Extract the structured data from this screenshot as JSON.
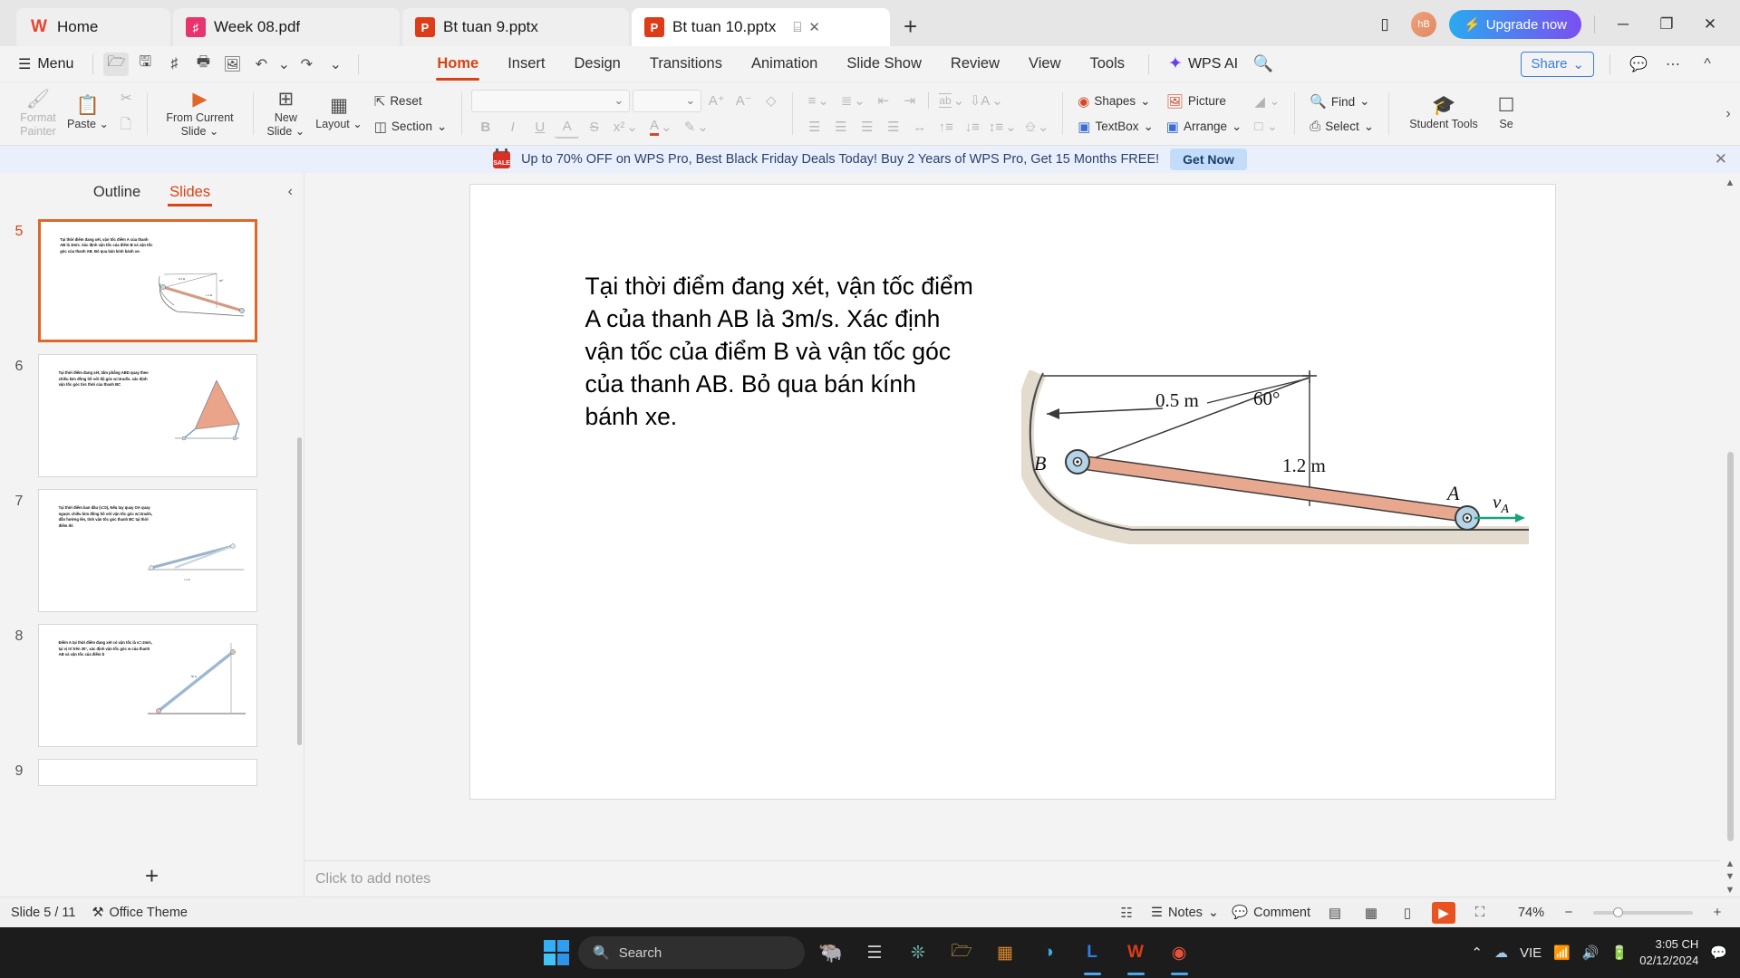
{
  "window_tabs": [
    {
      "label": "Home",
      "icon": "wps-logo-icon",
      "type": "home"
    },
    {
      "label": "Week 08.pdf",
      "icon": "pdf-icon",
      "type": "pdf"
    },
    {
      "label": "Bt tuan 9.pptx",
      "icon": "pptx-icon",
      "type": "ppt"
    },
    {
      "label": "Bt tuan 10.pptx",
      "icon": "pptx-icon",
      "type": "ppt",
      "active": true
    }
  ],
  "titlebar": {
    "new_tab": "+",
    "present_icon": "⌸",
    "close_tab_icon": "✕",
    "mobile_icon": "▯",
    "avatar_initials": "hB",
    "upgrade_label": "Upgrade now",
    "minimize": "─",
    "restore": "❐",
    "close": "✕"
  },
  "menubar": {
    "menu_label": "Menu",
    "quick_icons": [
      "open-folder-icon",
      "save-icon",
      "save-as-pdf-icon",
      "print-icon",
      "print-preview-icon",
      "undo-icon",
      "redo-icon",
      "customize-caret-icon"
    ],
    "tabs": [
      {
        "label": "Home",
        "active": true
      },
      {
        "label": "Insert",
        "active": false
      },
      {
        "label": "Design",
        "active": false
      },
      {
        "label": "Transitions",
        "active": false
      },
      {
        "label": "Animation",
        "active": false
      },
      {
        "label": "Slide Show",
        "active": false
      },
      {
        "label": "Review",
        "active": false
      },
      {
        "label": "View",
        "active": false
      },
      {
        "label": "Tools",
        "active": false
      }
    ],
    "wps_ai": "WPS AI",
    "search_icon": "search-icon",
    "share_label": "Share",
    "comment_icon": "comment-icon",
    "more_icon": "more-ellipsis-icon",
    "collapse_icon": "collapse-ribbon-icon"
  },
  "ribbon": {
    "format_painter": "Format\nPainter",
    "format_painter_l1": "Format",
    "format_painter_l2": "Painter",
    "paste": "Paste",
    "cut": "Cut",
    "copy": "Copy",
    "from_current_slide_l1": "From Current",
    "from_current_slide_l2": "Slide",
    "new_slide_l1": "New",
    "new_slide_l2": "Slide",
    "layout": "Layout",
    "reset": "Reset",
    "section": "Section",
    "font_name": "",
    "font_size": "",
    "increase_font": "A⁺",
    "decrease_font": "A⁻",
    "clear_format": "clear-formatting-icon",
    "bold": "B",
    "italic": "I",
    "underline": "U",
    "text_color_a": "A",
    "strikethrough": "S",
    "superscript": "x²",
    "font_color": "A",
    "highlight": "highlight-icon",
    "bullets": "bullets-icon",
    "numbering": "numbering-icon",
    "decrease_indent": "decrease-indent-icon",
    "increase_indent": "increase-indent-icon",
    "text_direction": "ab",
    "sort": "sort-icon",
    "align_left": "align-left-icon",
    "align_center": "align-center-icon",
    "align_right": "align-right-icon",
    "justify": "justify-icon",
    "distribute": "distribute-icon",
    "line_spacing_up": "raise-line-icon",
    "line_spacing_down": "lower-line-icon",
    "line_spacing": "line-spacing-icon",
    "text_box_fit": "textbox-fit-icon",
    "shapes": "Shapes",
    "picture": "Picture",
    "textbox": "TextBox",
    "arrange": "Arrange",
    "fill": "fill-color-icon",
    "outline": "shape-outline-icon",
    "find": "Find",
    "select": "Select",
    "student_tools_l1": "Student",
    "student_tools_l2": "Tools",
    "student_tools": "Student Tools",
    "se_cut": "Se",
    "expand_caret": "›"
  },
  "promo": {
    "icon": "sale-tag-icon",
    "message": "Up to 70% OFF on WPS Pro, Best Black Friday Deals Today! Buy 2 Years of WPS Pro, Get 15 Months FREE!",
    "cta": "Get Now",
    "close": "✕"
  },
  "sidebar": {
    "tabs": [
      {
        "label": "Outline",
        "active": false
      },
      {
        "label": "Slides",
        "active": true
      }
    ],
    "collapse_icon": "chevron-left-icon",
    "add_slide_icon": "+",
    "thumbnails": [
      {
        "number": "5",
        "selected": true,
        "text": "Tại thời điểm đang xét, vận tốc điểm A của thanh AB là 3m/s. Xác định vận tốc của điểm B và vận tốc góc của thanh AB. Bỏ qua bán kính bánh xe."
      },
      {
        "number": "6",
        "selected": false,
        "text": "Tại thời điểm đang xét, tấm phẳng ABD quay theo chiều kim đồng hồ với độ góc w=3rad/s. xác định vận tốc góc tức thời của thanh BC"
      },
      {
        "number": "7",
        "selected": false,
        "text": "Tại thời điểm ban đầu (v=0), Nếu tay quay OA quay nguợc chiều kim đồng hồ với vận tốc góc w=3rad/s, dẫn hướng lên, tính vận tốc góc thanh BC tại thời điểm đó"
      },
      {
        "number": "8",
        "selected": false,
        "text": "Điểm A tại thời điểm đang xét có vận tốc là v=-2m/s, tại vị trí trên 30°, xác định vận tốc góc w của thanh AB và vận tốc của điểm b"
      },
      {
        "number": "9",
        "selected": false,
        "text": ""
      }
    ]
  },
  "slide": {
    "body_text": "Tại thời điểm đang xét, vận tốc điểm A của thanh AB là 3m/s. Xác định vận tốc của điểm B và vận tốc góc của thanh AB. Bỏ qua bán kính bánh xe.",
    "diagram": {
      "label_b": "B",
      "label_a": "A",
      "label_va": "v",
      "label_va_sub": "A",
      "dim_top": "0.5 m",
      "angle": "60°",
      "dim_rod": "1.2 m",
      "rod_color": "#e8a890",
      "wheel_color": "#b6d4e8",
      "arrow_color": "#1aa37a"
    }
  },
  "notes": {
    "placeholder": "Click to add notes"
  },
  "statusbar": {
    "slide_count": "Slide 5 / 11",
    "theme_icon": "theme-icon",
    "theme": "Office Theme",
    "spellcheck_icon": "spellcheck-icon",
    "notes_label": "Notes",
    "comment_label": "Comment",
    "view_normal": "normal-view-icon",
    "view_sorter": "slide-sorter-icon",
    "view_reading": "reading-view-icon",
    "view_play": "start-slideshow-icon",
    "view_fit": "fit-to-window-icon",
    "zoom_level": "74%",
    "zoom_out": "−",
    "zoom_in": "+"
  },
  "taskbar": {
    "start_icon": "windows-start-icon",
    "search_placeholder": "Search",
    "widget_icon": "widgets-icon",
    "apps": [
      {
        "name": "task-view-icon",
        "glyph": "❐",
        "color": "#cccccc"
      },
      {
        "name": "chatgpt-icon",
        "glyph": "◈",
        "color": "#6fb9b0"
      },
      {
        "name": "file-explorer-icon",
        "glyph": "🗁",
        "color": "#e8b64c"
      },
      {
        "name": "app-store-icon",
        "glyph": "▦",
        "color": "#dd8a2c"
      },
      {
        "name": "edge-icon",
        "glyph": "◑",
        "color": "#3aaee0"
      },
      {
        "name": "zalo-icon",
        "glyph": "L",
        "color": "#2e7fe8"
      },
      {
        "name": "wps-office-icon",
        "glyph": "W",
        "color": "#dd3c18"
      },
      {
        "name": "chrome-icon",
        "glyph": "●",
        "color": "#e6513a"
      }
    ],
    "tray": {
      "chevron": "⌃",
      "cloud_icon": "cloud-icon",
      "language": "VIE",
      "wifi_icon": "wifi-icon",
      "volume_icon": "volume-icon",
      "battery_icon": "battery-icon",
      "time": "3:05 CH",
      "date": "02/12/2024",
      "notification_icon": "notification-icon"
    }
  }
}
